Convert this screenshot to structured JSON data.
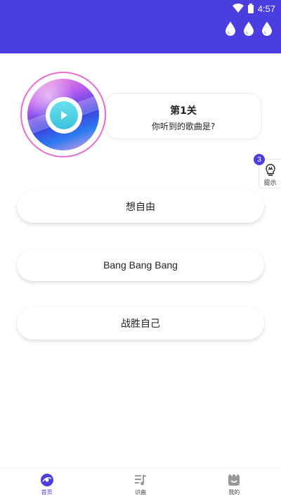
{
  "status_bar": {
    "time": "4:57"
  },
  "lives": {
    "count": 3,
    "icon": "water-drop-icon"
  },
  "level": {
    "title": "第1关",
    "question": "你听到的歌曲是?"
  },
  "hint": {
    "count": "3",
    "label": "提示"
  },
  "options": [
    {
      "label": "想自由"
    },
    {
      "label": "Bang Bang Bang"
    },
    {
      "label": "战胜自己"
    }
  ],
  "tabs": [
    {
      "label": "首页",
      "icon": "disc-icon",
      "active": true
    },
    {
      "label": "识曲",
      "icon": "music-list-icon",
      "active": false
    },
    {
      "label": "我的",
      "icon": "smiley-icon",
      "active": false
    }
  ],
  "colors": {
    "header": "#4a3ee0",
    "accent": "#4a3ee0",
    "disc_ring": "#e86ccf",
    "play_button": "#3ac2dc"
  }
}
